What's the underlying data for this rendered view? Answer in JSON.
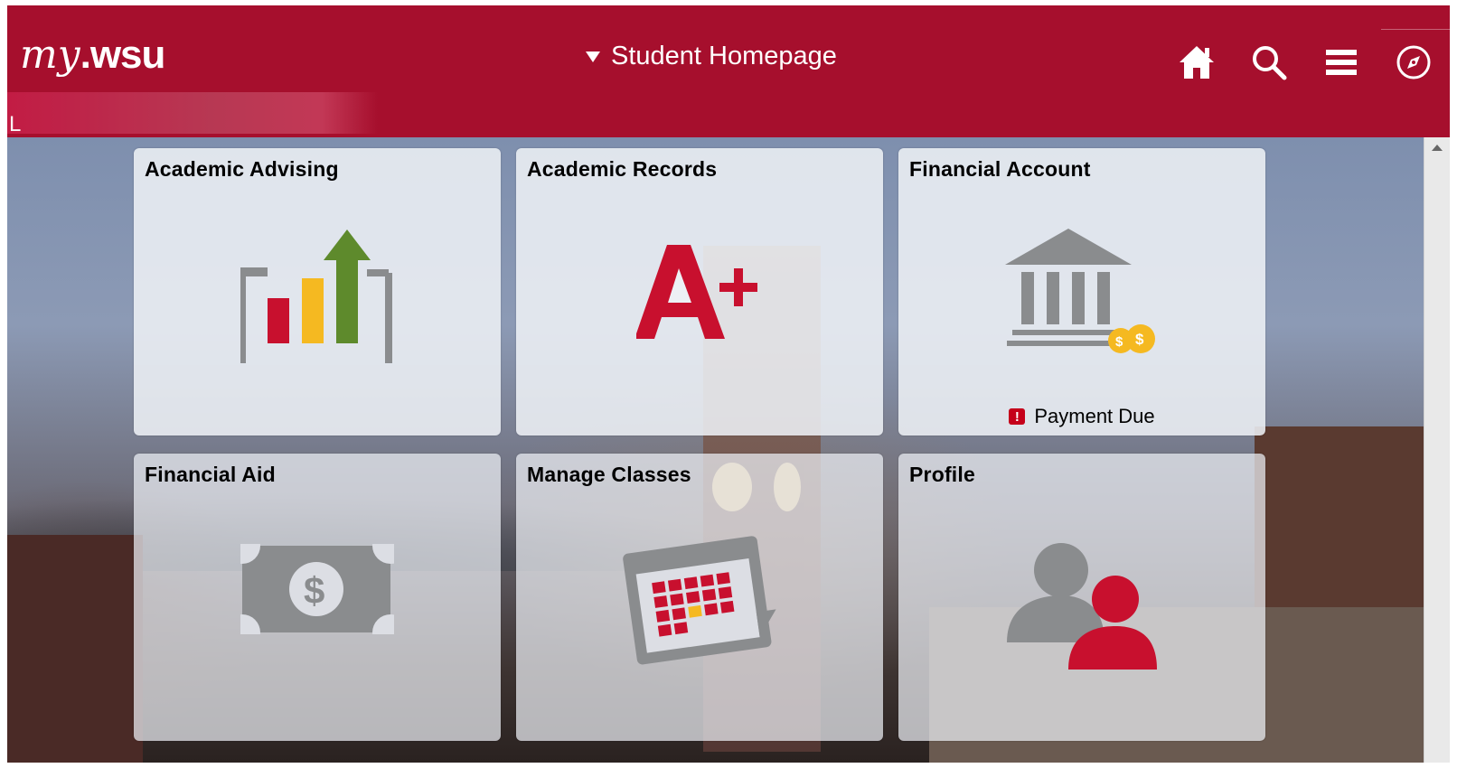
{
  "header": {
    "logo_my": "my",
    "logo_wsu": "WSU",
    "title": "Student Homepage",
    "user_initial": "L"
  },
  "icons": {
    "home": "home-icon",
    "search": "search-icon",
    "menu": "hamburger-menu-icon",
    "navigator": "compass-icon"
  },
  "tiles": [
    {
      "title": "Academic Advising",
      "icon": "bar-chart-growth-icon"
    },
    {
      "title": "Academic Records",
      "icon": "a-plus-grade-icon"
    },
    {
      "title": "Financial Account",
      "icon": "bank-building-icon",
      "status": "Payment Due"
    },
    {
      "title": "Financial Aid",
      "icon": "dollar-bill-icon"
    },
    {
      "title": "Manage Classes",
      "icon": "calendar-icon"
    },
    {
      "title": "Profile",
      "icon": "users-icon"
    }
  ],
  "colors": {
    "brand": "#a60f2d",
    "accent_red": "#c8102e",
    "accent_yellow": "#f5b921",
    "accent_green": "#5e8a2c",
    "icon_gray": "#8a8c8e"
  }
}
